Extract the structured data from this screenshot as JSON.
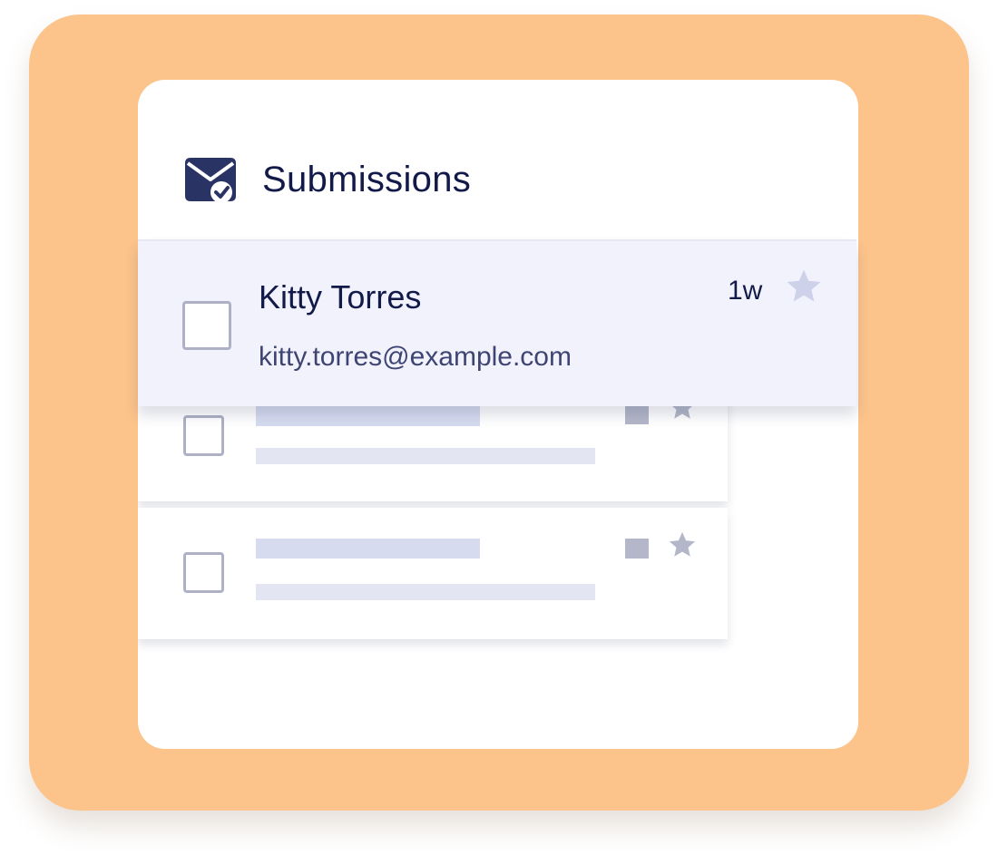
{
  "header": {
    "title": "Submissions",
    "icon": "mail-check-icon"
  },
  "featured_submission": {
    "name": "Kitty Torres",
    "email": "kitty.torres@example.com",
    "time_ago": "1w",
    "starred": false
  },
  "colors": {
    "backdrop": "#fcc38b",
    "panel": "#ffffff",
    "featured_row": "#f1f2fb",
    "primary_text": "#121a4a",
    "secondary_text": "#3e4573",
    "icon": "#2a3464",
    "star_inactive": "#cdd2ea"
  }
}
